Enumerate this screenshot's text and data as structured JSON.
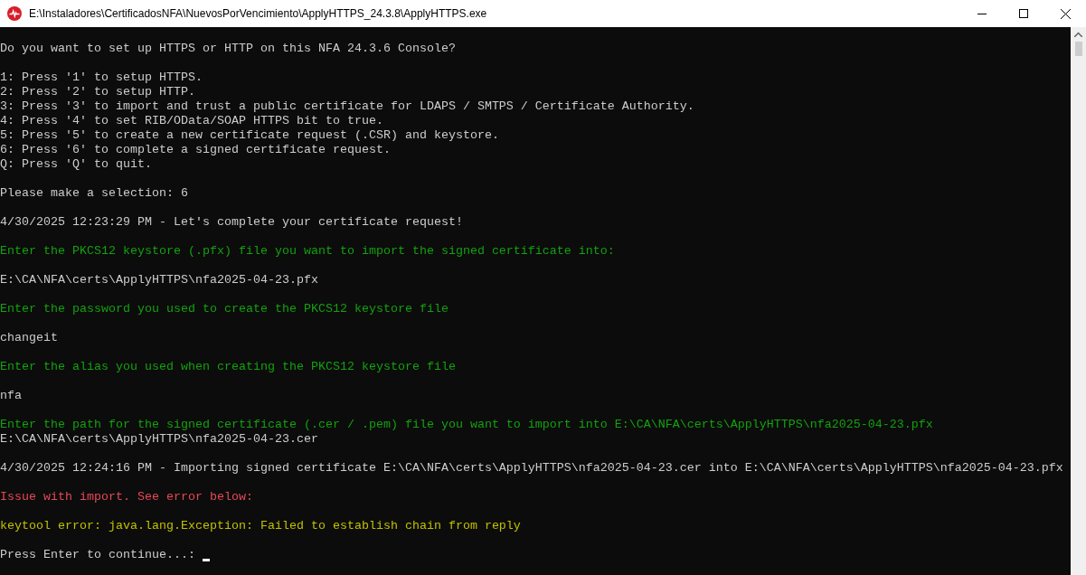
{
  "window": {
    "title": "E:\\Instaladores\\CertificadosNFA\\NuevosPorVencimiento\\ApplyHTTPS_24.3.8\\ApplyHTTPS.exe"
  },
  "console": {
    "blocks": [
      {
        "lines": [
          {
            "kind": "output",
            "text": "Do you want to set up HTTPS or HTTP on this NFA 24.3.6 Console?"
          }
        ]
      },
      {
        "lines": [
          {
            "kind": "output",
            "text": "1: Press '1' to setup HTTPS."
          },
          {
            "kind": "output",
            "text": "2: Press '2' to setup HTTP."
          },
          {
            "kind": "output",
            "text": "3: Press '3' to import and trust a public certificate for LDAPS / SMTPS / Certificate Authority."
          },
          {
            "kind": "output",
            "text": "4: Press '4' to set RIB/OData/SOAP HTTPS bit to true."
          },
          {
            "kind": "output",
            "text": "5: Press '5' to create a new certificate request (.CSR) and keystore."
          },
          {
            "kind": "output",
            "text": "6: Press '6' to complete a signed certificate request."
          },
          {
            "kind": "output",
            "text": "Q: Press 'Q' to quit."
          }
        ]
      },
      {
        "lines": [
          {
            "kind": "output",
            "text": "Please make a selection: 6"
          }
        ]
      },
      {
        "lines": [
          {
            "kind": "output",
            "text": "4/30/2025 12:23:29 PM - Let's complete your certificate request!"
          }
        ]
      },
      {
        "lines": [
          {
            "kind": "prompt",
            "text": "Enter the PKCS12 keystore (.pfx) file you want to import the signed certificate into:"
          }
        ]
      },
      {
        "lines": [
          {
            "kind": "output",
            "text": "E:\\CA\\NFA\\certs\\ApplyHTTPS\\nfa2025-04-23.pfx"
          }
        ]
      },
      {
        "lines": [
          {
            "kind": "prompt",
            "text": "Enter the password you used to create the PKCS12 keystore file"
          }
        ]
      },
      {
        "lines": [
          {
            "kind": "output",
            "text": "changeit"
          }
        ]
      },
      {
        "lines": [
          {
            "kind": "prompt",
            "text": "Enter the alias you used when creating the PKCS12 keystore file"
          }
        ]
      },
      {
        "lines": [
          {
            "kind": "output",
            "text": "nfa"
          }
        ]
      },
      {
        "lines": [
          {
            "kind": "prompt",
            "text": "Enter the path for the signed certificate (.cer / .pem) file you want to import into E:\\CA\\NFA\\certs\\ApplyHTTPS\\nfa2025-04-23.pfx"
          },
          {
            "kind": "output",
            "text": "E:\\CA\\NFA\\certs\\ApplyHTTPS\\nfa2025-04-23.cer"
          }
        ]
      },
      {
        "lines": [
          {
            "kind": "output",
            "text": "4/30/2025 12:24:16 PM - Importing signed certificate E:\\CA\\NFA\\certs\\ApplyHTTPS\\nfa2025-04-23.cer into E:\\CA\\NFA\\certs\\ApplyHTTPS\\nfa2025-04-23.pfx"
          }
        ]
      },
      {
        "lines": [
          {
            "kind": "error",
            "text": "Issue with import. See error below:"
          }
        ]
      },
      {
        "lines": [
          {
            "kind": "warning",
            "text": "keytool error: java.lang.Exception: Failed to establish chain from reply"
          }
        ]
      },
      {
        "lines": [
          {
            "kind": "input",
            "text": "Press Enter to continue...: "
          }
        ]
      }
    ]
  }
}
